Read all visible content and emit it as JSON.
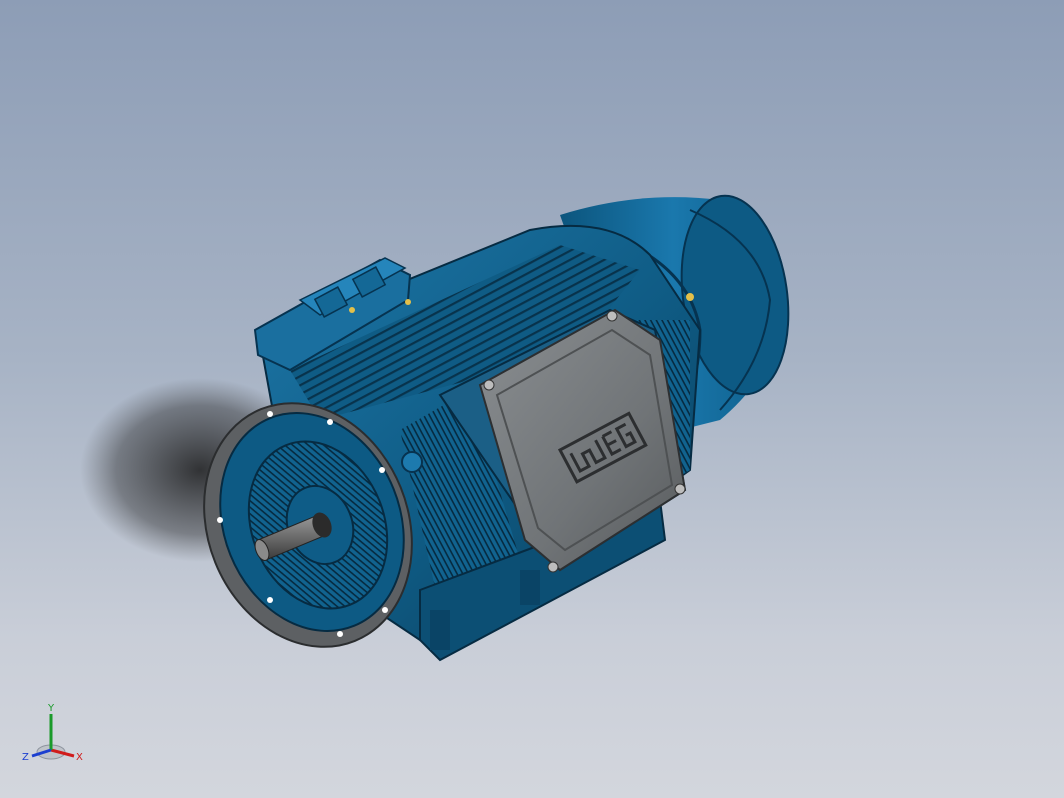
{
  "viewport": {
    "background_top": "#8d9db6",
    "background_bottom": "#d3d6dd"
  },
  "model": {
    "body_color": "#0f5b84",
    "body_dark": "#0a3f5e",
    "terminal_box_color": "#707477",
    "brand_logo": "weg"
  },
  "triad": {
    "x_label": "X",
    "y_label": "Y",
    "z_label": "Z",
    "x_color": "#d01c1c",
    "y_color": "#1a9a2a",
    "z_color": "#1c3fd0"
  }
}
